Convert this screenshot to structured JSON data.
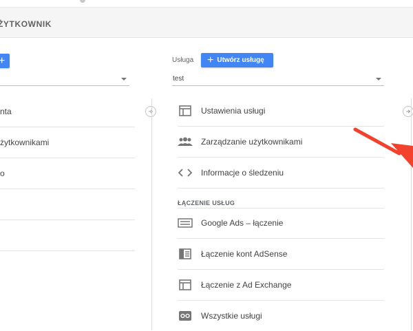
{
  "header": {
    "title": "żytkownik"
  },
  "left_column": {
    "items": [
      {
        "label": "nta"
      },
      {
        "label": "żytkownikami"
      },
      {
        "label": "o"
      }
    ]
  },
  "service_column": {
    "label": "Usługa",
    "create_button": "Utwórz usługę",
    "selected": "test",
    "items": [
      {
        "label": "Ustawienia usługi",
        "icon": "service-settings-icon"
      },
      {
        "label": "Zarządzanie użytkownikami",
        "icon": "users-icon"
      },
      {
        "label": "Informacje o śledzeniu",
        "icon": "code-icon"
      }
    ],
    "section_title": "ŁĄCZENIE USŁUG",
    "linking_items": [
      {
        "label": "Google Ads – łączenie",
        "icon": "google-ads-icon"
      },
      {
        "label": "Łączenie kont AdSense",
        "icon": "adsense-icon"
      },
      {
        "label": "Łączenie z Ad Exchange",
        "icon": "ad-exchange-icon"
      },
      {
        "label": "Wszystkie usługi",
        "icon": "all-products-icon"
      }
    ]
  },
  "colors": {
    "accent": "#4285f4",
    "arrow": "#f2412c"
  }
}
